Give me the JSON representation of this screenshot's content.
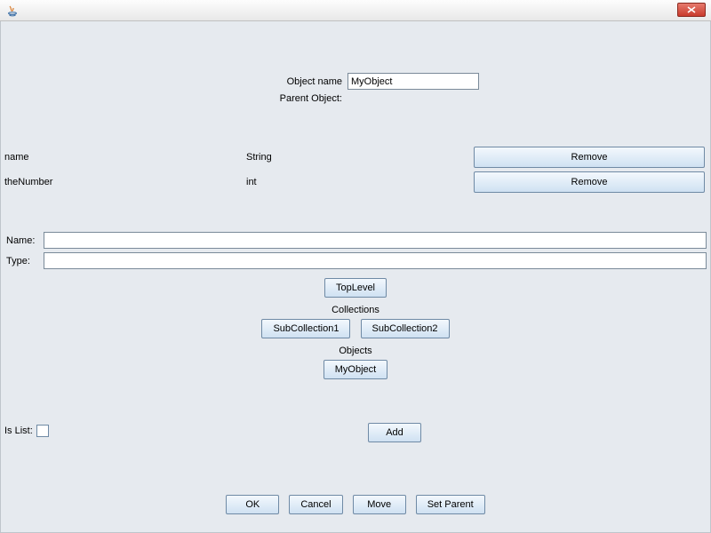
{
  "header": {
    "object_name_label": "Object name",
    "object_name_value": "MyObject",
    "parent_object_label": "Parent Object:"
  },
  "properties": [
    {
      "name": "name",
      "type": "String",
      "action": "Remove"
    },
    {
      "name": "theNumber",
      "type": "int",
      "action": "Remove"
    }
  ],
  "edit": {
    "name_label": "Name:",
    "name_value": "",
    "type_label": "Type:",
    "type_value": ""
  },
  "mid": {
    "toplevel": "TopLevel",
    "collections_label": "Collections",
    "collections": [
      "SubCollection1",
      "SubCollection2"
    ],
    "objects_label": "Objects",
    "objects": [
      "MyObject"
    ],
    "add": "Add"
  },
  "islist_label": "Is List:",
  "bottom": {
    "ok": "OK",
    "cancel": "Cancel",
    "move": "Move",
    "set_parent": "Set Parent"
  }
}
